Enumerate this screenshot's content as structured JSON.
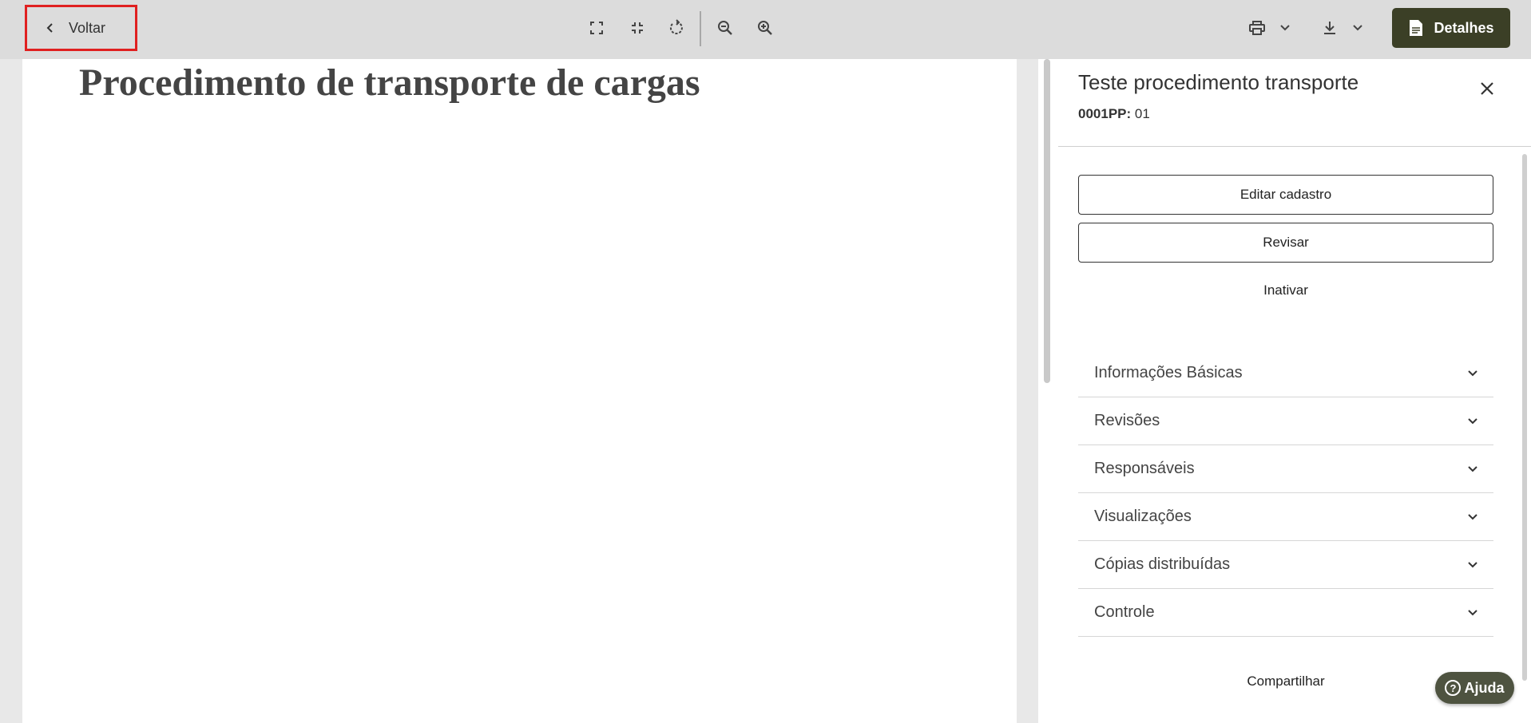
{
  "toolbar": {
    "back_label": "Voltar",
    "details_label": "Detalhes",
    "icons": [
      "fullscreen-icon",
      "exit-fullscreen-icon",
      "rotate-icon",
      "zoom-out-icon",
      "zoom-in-icon",
      "print-icon",
      "chevron-down-icon",
      "download-icon",
      "chevron-down-icon",
      "document-icon"
    ]
  },
  "document": {
    "title": "Procedimento de transporte de cargas"
  },
  "panel": {
    "title": "Teste procedimento transporte",
    "code_label": "0001PP:",
    "code_value": "01",
    "actions": {
      "edit": "Editar cadastro",
      "review": "Revisar",
      "deactivate": "Inativar",
      "share": "Compartilhar"
    },
    "sections": [
      {
        "label": "Informações Básicas"
      },
      {
        "label": "Revisões"
      },
      {
        "label": "Responsáveis"
      },
      {
        "label": "Visualizações"
      },
      {
        "label": "Cópias distribuídas"
      },
      {
        "label": "Controle"
      }
    ]
  },
  "help": {
    "label": "Ajuda",
    "glyph": "?"
  },
  "colors": {
    "details_bg": "#3b3f26",
    "highlight_border": "#e02020",
    "help_bg": "#4e5340"
  }
}
